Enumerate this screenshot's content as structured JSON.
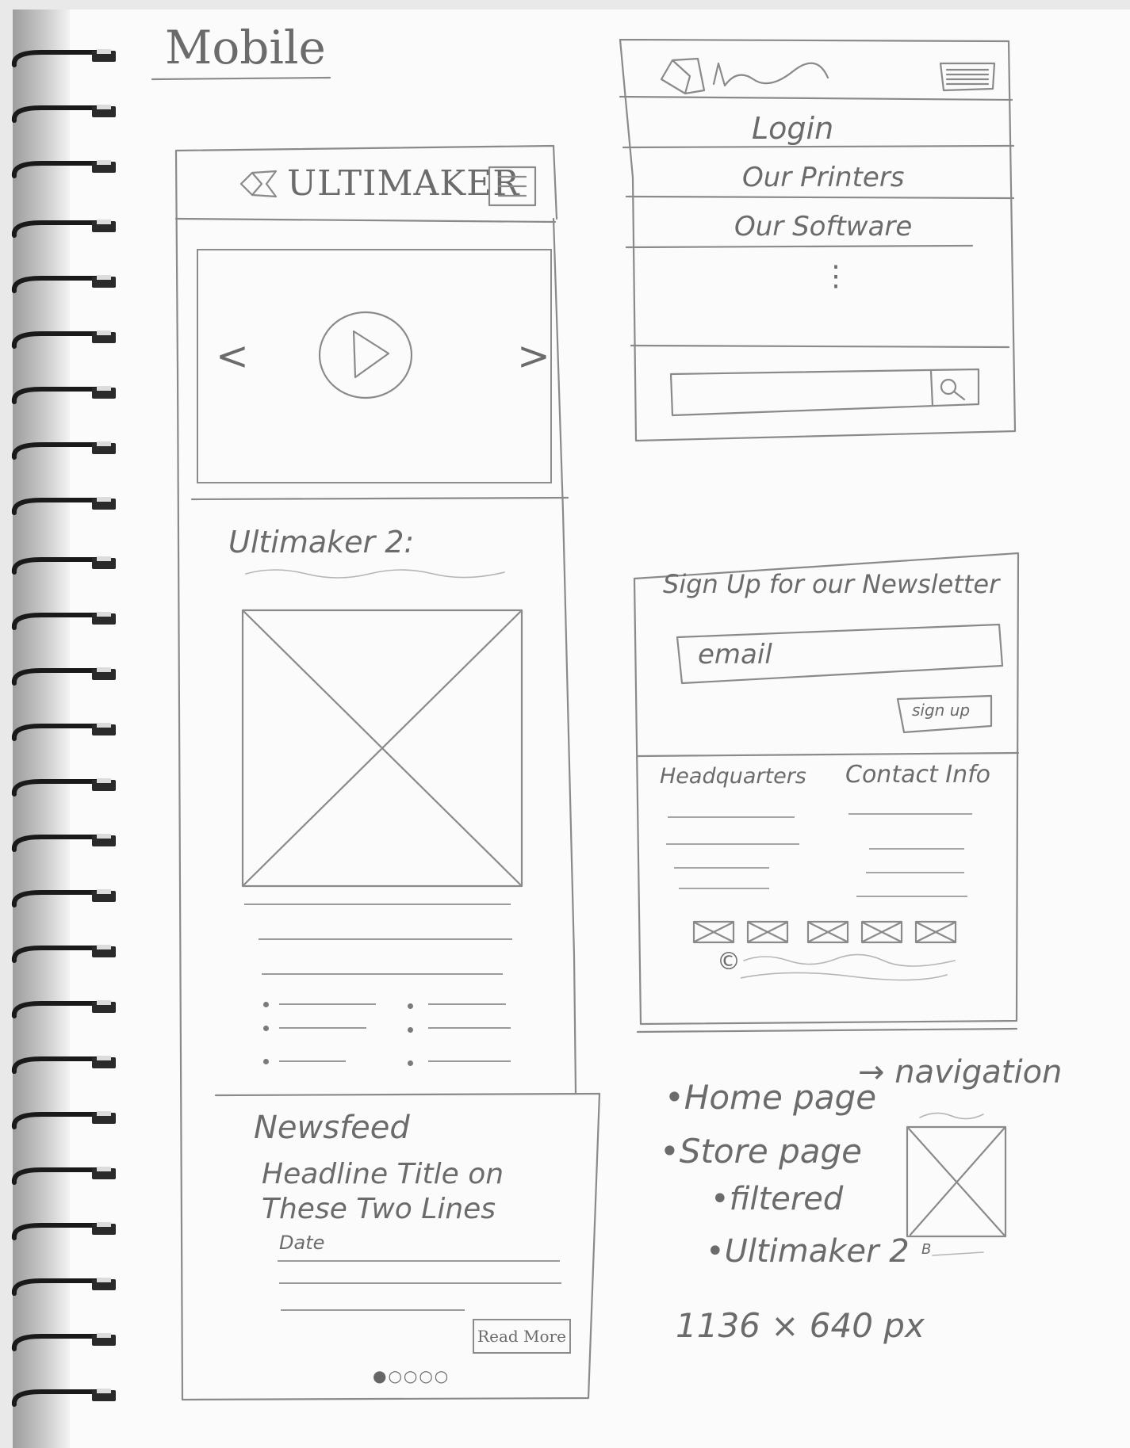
{
  "page_heading": "Mobile",
  "phone": {
    "logo_text": "ULTIMAKER",
    "menu_icon": "hamburger-icon",
    "carousel": {
      "prev": "<",
      "next": ">",
      "play_icon": "play-icon"
    },
    "product_title": "Ultimaker 2:",
    "newsfeed": {
      "title": "Newsfeed",
      "headline": [
        "Headline Title on",
        "These Two Lines"
      ],
      "date": "Date",
      "read_more": "Read More",
      "pager": "●○○○○"
    }
  },
  "menu": {
    "items": [
      "Login",
      "Our Printers",
      "Our Software"
    ],
    "ellipsis": "⋮",
    "search_icon": "search-icon"
  },
  "footer": {
    "newsletter_title": "Sign Up for our Newsletter",
    "email_placeholder": "email",
    "signup_button": "sign up",
    "headquarters": "Headquarters",
    "contact_info": "Contact Info",
    "copyright": "©"
  },
  "notes": {
    "items": [
      "Home page",
      "Store page",
      "filtered",
      "Ultimaker 2"
    ],
    "arrow_label": "→ navigation",
    "thumb_caption": "B",
    "dimensions": "1136 × 640 px"
  }
}
